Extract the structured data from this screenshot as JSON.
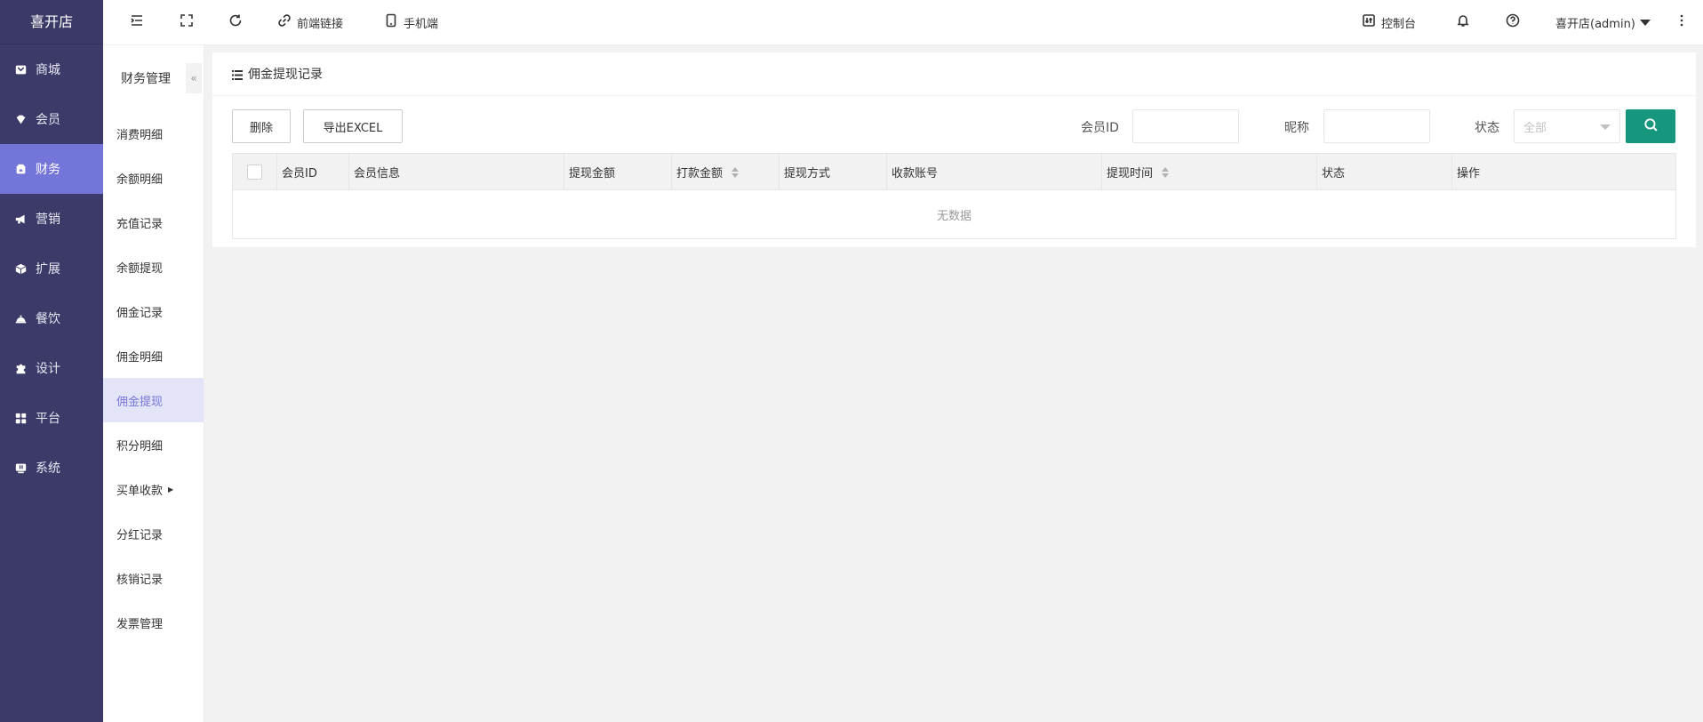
{
  "app": {
    "title": "喜开店"
  },
  "primary_nav": [
    {
      "label": "商城",
      "icon": "mall-icon"
    },
    {
      "label": "会员",
      "icon": "member-icon"
    },
    {
      "label": "财务",
      "icon": "finance-icon",
      "active": true
    },
    {
      "label": "营销",
      "icon": "megaphone-icon"
    },
    {
      "label": "扩展",
      "icon": "cube-icon"
    },
    {
      "label": "餐饮",
      "icon": "dining-icon"
    },
    {
      "label": "设计",
      "icon": "puzzle-icon"
    },
    {
      "label": "平台",
      "icon": "grid-icon"
    },
    {
      "label": "系统",
      "icon": "system-icon"
    }
  ],
  "topbar": {
    "frontend_link": "前端链接",
    "mobile": "手机端",
    "console": "控制台",
    "user": "喜开店(admin)"
  },
  "secondary_nav": {
    "title": "财务管理",
    "collapse": "«",
    "items": [
      {
        "label": "消费明细"
      },
      {
        "label": "余额明细"
      },
      {
        "label": "充值记录"
      },
      {
        "label": "余额提现"
      },
      {
        "label": "佣金记录"
      },
      {
        "label": "佣金明细"
      },
      {
        "label": "佣金提现",
        "active": true
      },
      {
        "label": "积分明细"
      },
      {
        "label": "买单收款",
        "has_submenu": true
      },
      {
        "label": "分红记录"
      },
      {
        "label": "核销记录"
      },
      {
        "label": "发票管理"
      }
    ]
  },
  "page": {
    "title": "佣金提现记录",
    "delete_button": "删除",
    "export_button": "导出EXCEL",
    "filters": {
      "member_id_label": "会员ID",
      "nickname_label": "昵称",
      "status_label": "状态",
      "status_value": "全部"
    }
  },
  "table": {
    "columns": [
      {
        "label": "会员ID",
        "sortable": false
      },
      {
        "label": "会员信息",
        "sortable": false
      },
      {
        "label": "提现金额",
        "sortable": false
      },
      {
        "label": "打款金额",
        "sortable": true
      },
      {
        "label": "提现方式",
        "sortable": false
      },
      {
        "label": "收款账号",
        "sortable": false
      },
      {
        "label": "提现时间",
        "sortable": true
      },
      {
        "label": "状态",
        "sortable": false
      },
      {
        "label": "操作",
        "sortable": false
      }
    ],
    "empty_text": "无数据"
  },
  "colors": {
    "sidebar_bg": "#3b3a69",
    "active_nav": "#7475d9",
    "search_button": "#16977d"
  }
}
